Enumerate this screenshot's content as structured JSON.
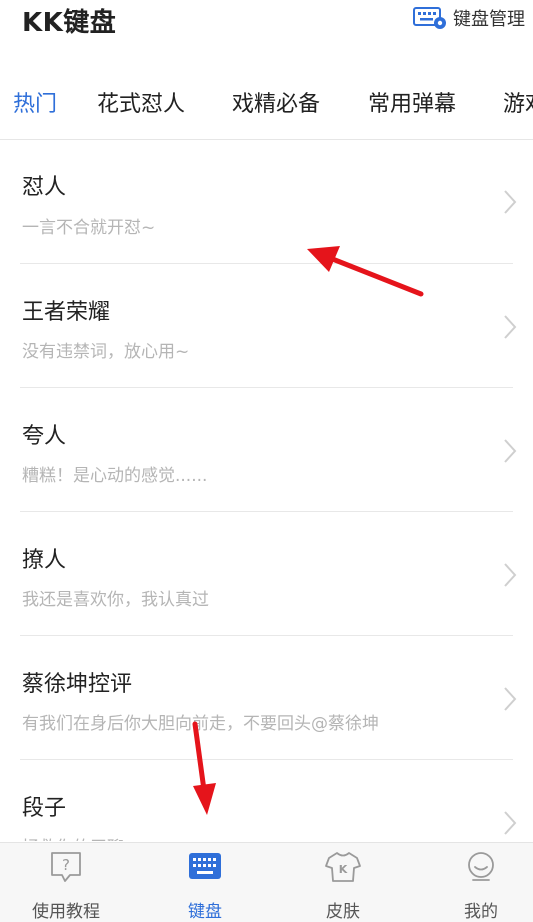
{
  "header": {
    "title": "KK键盘",
    "manage_label": "键盘管理",
    "manage_icon": "keyboard-settings-icon"
  },
  "tabs": [
    {
      "label": "热门",
      "active": true
    },
    {
      "label": "花式怼人",
      "active": false
    },
    {
      "label": "戏精必备",
      "active": false
    },
    {
      "label": "常用弹幕",
      "active": false
    },
    {
      "label": "游戏",
      "active": false
    }
  ],
  "list": [
    {
      "title": "怼人",
      "subtitle": "一言不合就开怼~"
    },
    {
      "title": "王者荣耀",
      "subtitle": "没有违禁词，放心用~"
    },
    {
      "title": "夸人",
      "subtitle": "糟糕！是心动的感觉......"
    },
    {
      "title": "撩人",
      "subtitle": "我还是喜欢你，我认真过"
    },
    {
      "title": "蔡徐坤控评",
      "subtitle": "有我们在身后你大胆向前走，不要回头@蔡徐坤"
    },
    {
      "title": "段子",
      "subtitle": "拯救你的无聊"
    }
  ],
  "bottom_nav": [
    {
      "label": "使用教程",
      "icon": "help-question-icon",
      "active": false
    },
    {
      "label": "键盘",
      "icon": "keyboard-icon",
      "active": true
    },
    {
      "label": "皮肤",
      "icon": "tshirt-skin-icon",
      "active": false
    },
    {
      "label": "我的",
      "icon": "profile-face-icon",
      "active": false
    }
  ],
  "colors": {
    "accent": "#2f6fd9",
    "annotation_arrow": "#e5141b",
    "subtitle_gray": "#b5b5b5"
  }
}
